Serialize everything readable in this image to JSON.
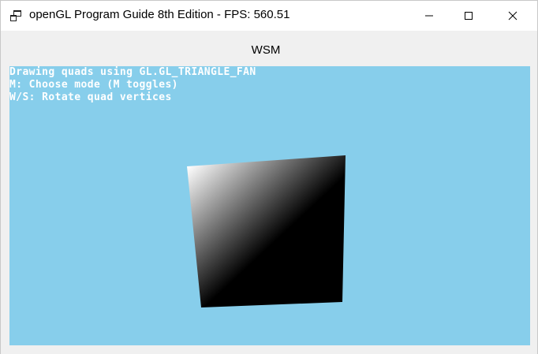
{
  "window": {
    "title": "openGL Program Guide 8th Edition - FPS: 560.51",
    "app_icon": "app-window-icon",
    "buttons": {
      "minimize_icon": "minimize-icon",
      "maximize_icon": "maximize-icon",
      "close_icon": "close-icon"
    }
  },
  "panel": {
    "label": "WSM"
  },
  "gl_view": {
    "background_color": "#87ceeb",
    "overlay_lines": [
      "Drawing quads using GL.GL_TRIANGLE_FAN",
      "M: Choose mode (M toggles)",
      "W/S: Rotate quad vertices"
    ],
    "quad": {
      "fill_start": "#ffffff",
      "fill_end": "#000000"
    }
  }
}
